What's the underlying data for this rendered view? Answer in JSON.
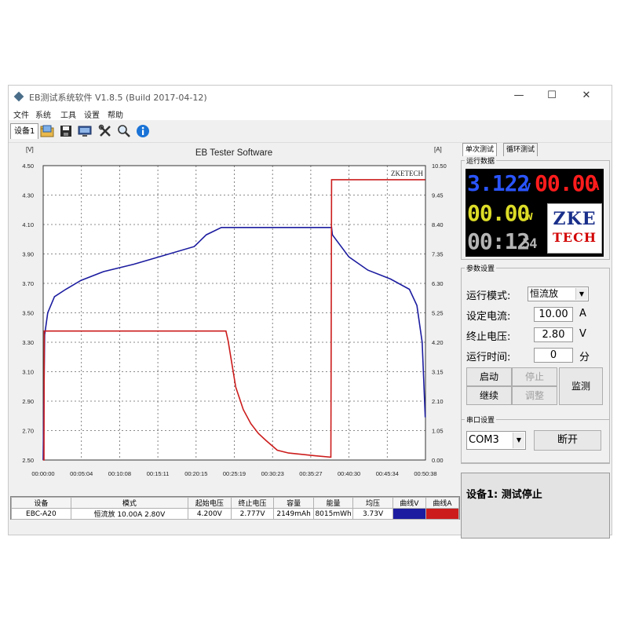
{
  "window": {
    "title": "EB测试系统软件 V1.8.5 (Build 2017-04-12)",
    "controls": {
      "minimize": "—",
      "maximize": "☐",
      "close": "✕"
    }
  },
  "menu": [
    "文件",
    "系统",
    "工具",
    "设置",
    "帮助"
  ],
  "toolbar": {
    "device_tab": "设备1",
    "buttons": [
      "open-folder-icon",
      "save-icon",
      "monitor-icon",
      "tools-icon",
      "search-icon",
      "info-icon"
    ]
  },
  "chart": {
    "title": "EB Tester Software",
    "left_unit": "[V]",
    "right_unit": "[A]",
    "watermark": "ZKETECH",
    "left_ticks": [
      "4.50",
      "4.30",
      "4.10",
      "3.90",
      "3.70",
      "3.50",
      "3.30",
      "3.10",
      "2.90",
      "2.70",
      "2.50"
    ],
    "right_ticks": [
      "10.50",
      "9.45",
      "8.40",
      "7.35",
      "6.30",
      "5.25",
      "4.20",
      "3.15",
      "2.10",
      "1.05",
      "0.00"
    ],
    "x_ticks": [
      "00:00:00",
      "00:05:04",
      "00:10:08",
      "00:15:11",
      "00:20:15",
      "00:25:19",
      "00:30:23",
      "00:35:27",
      "00:40:30",
      "00:45:34",
      "00:50:38"
    ],
    "colors": {
      "voltage": "#1c1ca0",
      "current": "#cc1c1c"
    }
  },
  "chart_data": {
    "type": "line",
    "title": "EB Tester Software",
    "xlabel": "",
    "ylabel": "[V]",
    "y2label": "[A]",
    "x_unit": "minutes",
    "xlim": [
      0,
      50.633
    ],
    "ylim": [
      2.5,
      4.5
    ],
    "y2lim": [
      0,
      10.5
    ],
    "grid": true,
    "series": [
      {
        "axis": "left",
        "points": [
          [
            0,
            2.5
          ],
          [
            0.2,
            3.35
          ],
          [
            0.6,
            3.5
          ],
          [
            1.5,
            3.61
          ],
          [
            3,
            3.66
          ],
          [
            5,
            3.72
          ],
          [
            8,
            3.78
          ],
          [
            12,
            3.83
          ],
          [
            16,
            3.89
          ],
          [
            20,
            3.95
          ],
          [
            21.6,
            4.03
          ],
          [
            23.6,
            4.08
          ],
          [
            24.6,
            4.08
          ],
          [
            35,
            4.08
          ],
          [
            38.2,
            4.08
          ],
          [
            38.3,
            4.03
          ],
          [
            40.5,
            3.88
          ],
          [
            43,
            3.79
          ],
          [
            46,
            3.73
          ],
          [
            48.5,
            3.66
          ],
          [
            49.5,
            3.55
          ],
          [
            50.2,
            3.3
          ],
          [
            50.6,
            2.79
          ]
        ]
      },
      {
        "axis": "right",
        "points": [
          [
            0,
            0
          ],
          [
            0.1,
            0
          ],
          [
            0.15,
            4.6
          ],
          [
            24.2,
            4.6
          ],
          [
            24.5,
            4.25
          ],
          [
            25.5,
            2.6
          ],
          [
            26.5,
            1.8
          ],
          [
            27.5,
            1.3
          ],
          [
            28.5,
            0.95
          ],
          [
            29.5,
            0.7
          ],
          [
            31,
            0.35
          ],
          [
            32.5,
            0.25
          ],
          [
            36,
            0.15
          ],
          [
            38.1,
            0.1
          ],
          [
            38.2,
            10
          ],
          [
            50.6,
            10
          ]
        ]
      }
    ]
  },
  "summary": {
    "headers": [
      "设备",
      "模式",
      "起始电压",
      "终止电压",
      "容量",
      "能量",
      "均压",
      "曲线V",
      "曲线A"
    ],
    "row": [
      "EBC-A20",
      "恒流放  10.00A  2.80V",
      "4.200V",
      "2.777V",
      "2149mAh",
      "8015mWh",
      "3.73V",
      "",
      ""
    ]
  },
  "tabs": [
    "单次测试",
    "循环测试"
  ],
  "run_data": {
    "label": "运行数据",
    "voltage": "3.122",
    "voltage_unit": "v",
    "current": "00.00",
    "current_unit": "A",
    "power": "00.00",
    "power_unit": "w",
    "time": "00:12",
    "time_sec": "54",
    "logo_top": "ZKE",
    "logo_bottom": "TECH",
    "colors": {
      "voltage": "#2a55ff",
      "current": "#ff1c1c",
      "power": "#dcdc28",
      "time": "#b4b4b4"
    }
  },
  "params": {
    "label": "参数设置",
    "mode_label": "运行模式:",
    "mode_value": "恒流放",
    "current_label": "设定电流:",
    "current_value": "10.00",
    "current_unit": "A",
    "cutoff_label": "终止电压:",
    "cutoff_value": "2.80",
    "cutoff_unit": "V",
    "time_label": "运行时间:",
    "time_value": "0",
    "time_unit": "分",
    "buttons": {
      "start": "启动",
      "stop": "停止",
      "continue": "继续",
      "adjust": "调整",
      "monitor": "监测"
    }
  },
  "serial": {
    "label": "串口设置",
    "port": "COM3",
    "disconnect": "断开"
  },
  "status": "设备1: 测试停止"
}
